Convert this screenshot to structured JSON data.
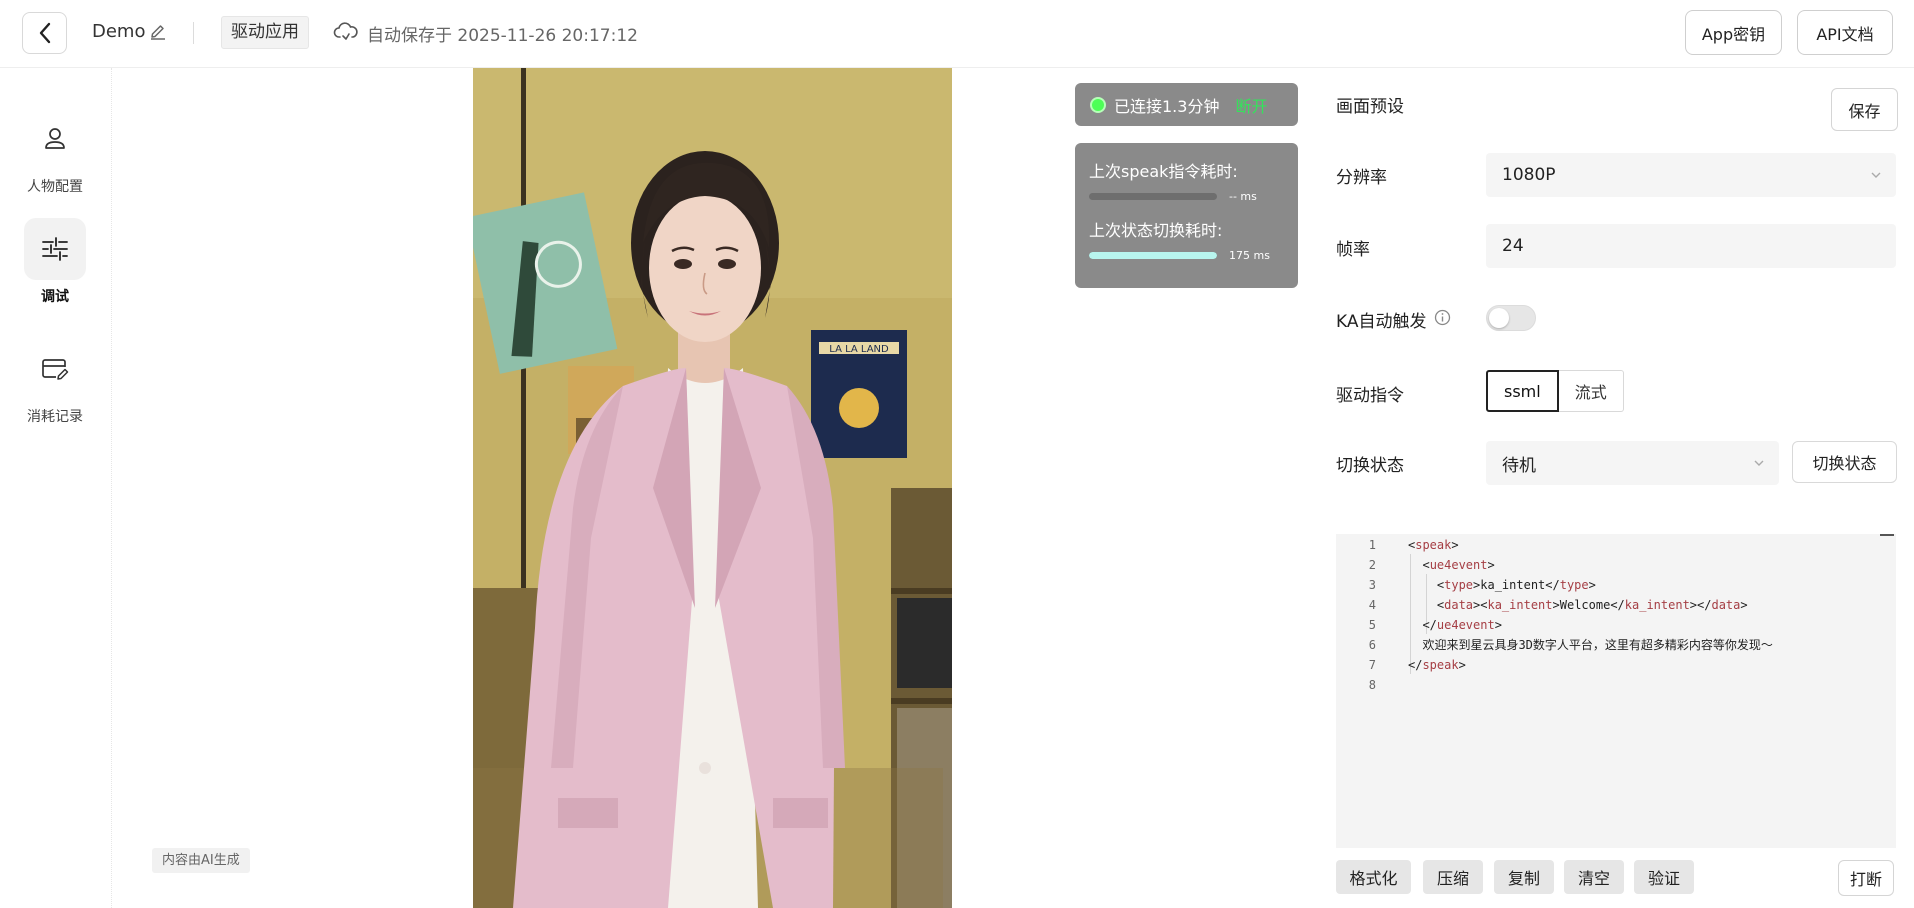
{
  "header": {
    "app_name": "Demo",
    "tag": "驱动应用",
    "autosave": "自动保存于 2025-11-26 20:17:12",
    "app_key_label": "App密钥",
    "api_doc_label": "API文档"
  },
  "nav": [
    {
      "label": "人物配置",
      "icon": "person-icon",
      "active": false
    },
    {
      "label": "调试",
      "icon": "sliders-icon",
      "active": true
    },
    {
      "label": "消耗记录",
      "icon": "card-edit-icon",
      "active": false
    }
  ],
  "stage": {
    "ai_badge": "内容由AI生成",
    "poster_text": "LA LA LAND"
  },
  "status": {
    "connected": "已连接1.3分钟",
    "refresh": "断开",
    "speak_label": "上次speak指令耗时:",
    "speak_value": "-- ms",
    "speak_fill": 0,
    "state_label": "上次状态切换耗时:",
    "state_value": "175 ms",
    "state_fill": 1.0
  },
  "config": {
    "preset_label": "画面预设",
    "save_label": "保存",
    "resolution_label": "分辨率",
    "resolution_value": "1080P",
    "fps_label": "帧率",
    "fps_value": "24",
    "ka_label": "KA自动触发",
    "ka_enabled": false,
    "drive_label": "驱动指令",
    "drive_options": [
      "ssml",
      "流式"
    ],
    "drive_selected": "ssml",
    "state_label": "切换状态",
    "state_value": "待机",
    "switch_label": "切换状态"
  },
  "editor": {
    "lines": [
      {
        "n": "1",
        "t": "<speak>"
      },
      {
        "n": "2",
        "t": "  <ue4event>"
      },
      {
        "n": "3",
        "t": "    <type>ka_intent</type>"
      },
      {
        "n": "4",
        "t": "    <data><ka_intent>Welcome</ka_intent></data>"
      },
      {
        "n": "5",
        "t": "  </ue4event>"
      },
      {
        "n": "6",
        "t": "  欢迎来到星云具身3D数字人平台，这里有超多精彩内容等你发现～"
      },
      {
        "n": "7",
        "t": "</speak>"
      },
      {
        "n": "8",
        "t": ""
      }
    ]
  },
  "tools": {
    "format": "格式化",
    "compress": "压缩",
    "copy": "复制",
    "clear": "清空",
    "validate": "验证",
    "interrupt": "打断"
  }
}
